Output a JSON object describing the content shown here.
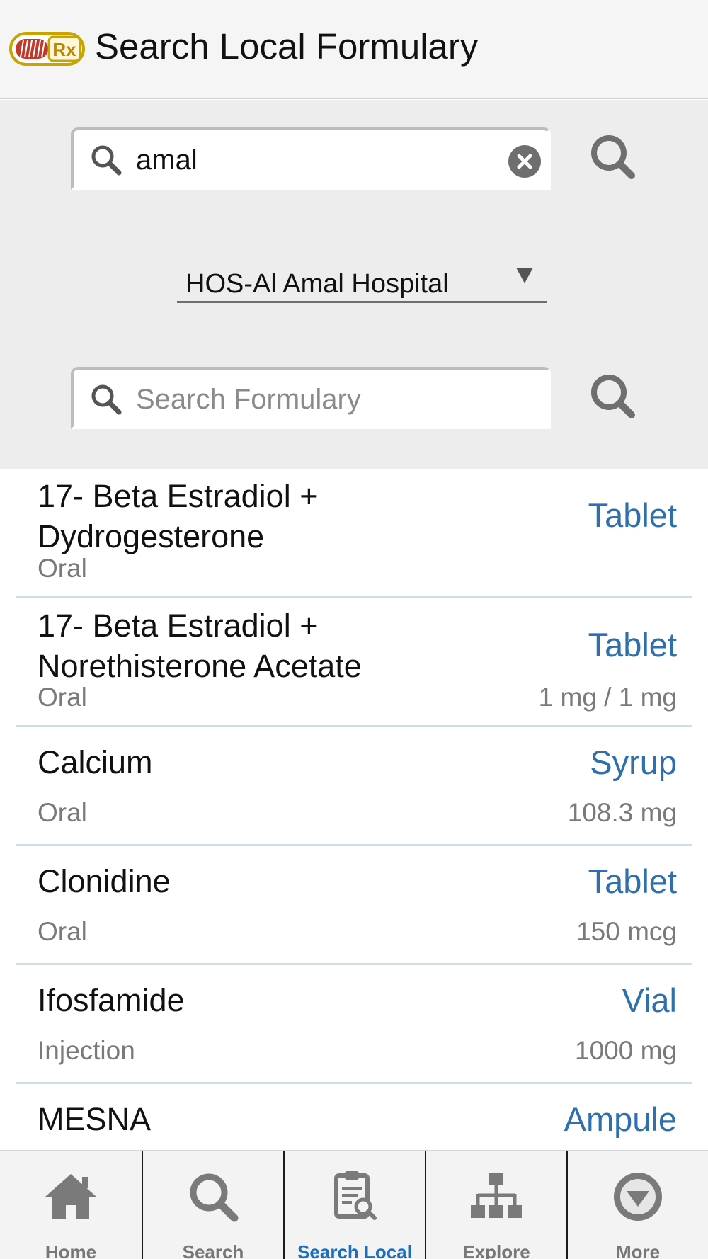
{
  "header": {
    "title": "Search Local Formulary",
    "logo_icon": "rx-logo-icon",
    "logo_text": "Rx"
  },
  "drug_search": {
    "value": "amal",
    "icon": "search-icon",
    "clear_icon": "clear-icon",
    "submit_icon": "search-icon"
  },
  "hospital_select": {
    "selected": "HOS-Al Amal Hospital",
    "icon": "dropdown-arrow-icon"
  },
  "formulary_search": {
    "value": "",
    "placeholder": "Search Formulary",
    "icon": "search-icon",
    "submit_icon": "search-icon"
  },
  "results": [
    {
      "name": "17- Beta Estradiol + Dydrogesterone",
      "form": "Tablet",
      "route": "Oral",
      "dose": ""
    },
    {
      "name": "17- Beta Estradiol + Norethisterone Acetate",
      "form": "Tablet",
      "route": "Oral",
      "dose": "1 mg / 1 mg"
    },
    {
      "name": "Calcium",
      "form": "Syrup",
      "route": "Oral",
      "dose": "108.3 mg"
    },
    {
      "name": "Clonidine",
      "form": "Tablet",
      "route": "Oral",
      "dose": "150 mcg"
    },
    {
      "name": "Ifosfamide",
      "form": "Vial",
      "route": "Injection",
      "dose": "1000 mg"
    },
    {
      "name": "MESNA",
      "form": "Ampule",
      "route": "",
      "dose": ""
    }
  ],
  "tabs": [
    {
      "label": "Home",
      "icon": "home-icon",
      "active": false
    },
    {
      "label": "Search",
      "icon": "search-icon",
      "active": false
    },
    {
      "label": "Search Local",
      "icon": "clipboard-search-icon",
      "active": true
    },
    {
      "label": "Explore",
      "icon": "hierarchy-icon",
      "active": false
    },
    {
      "label": "More",
      "icon": "more-down-icon",
      "active": false
    }
  ],
  "colors": {
    "accent": "#1a6fc4",
    "dosage_form": "#2f6fad",
    "secondary_text": "#7a7a7a",
    "logo_gold": "#c9a400",
    "logo_red": "#c0392b"
  }
}
